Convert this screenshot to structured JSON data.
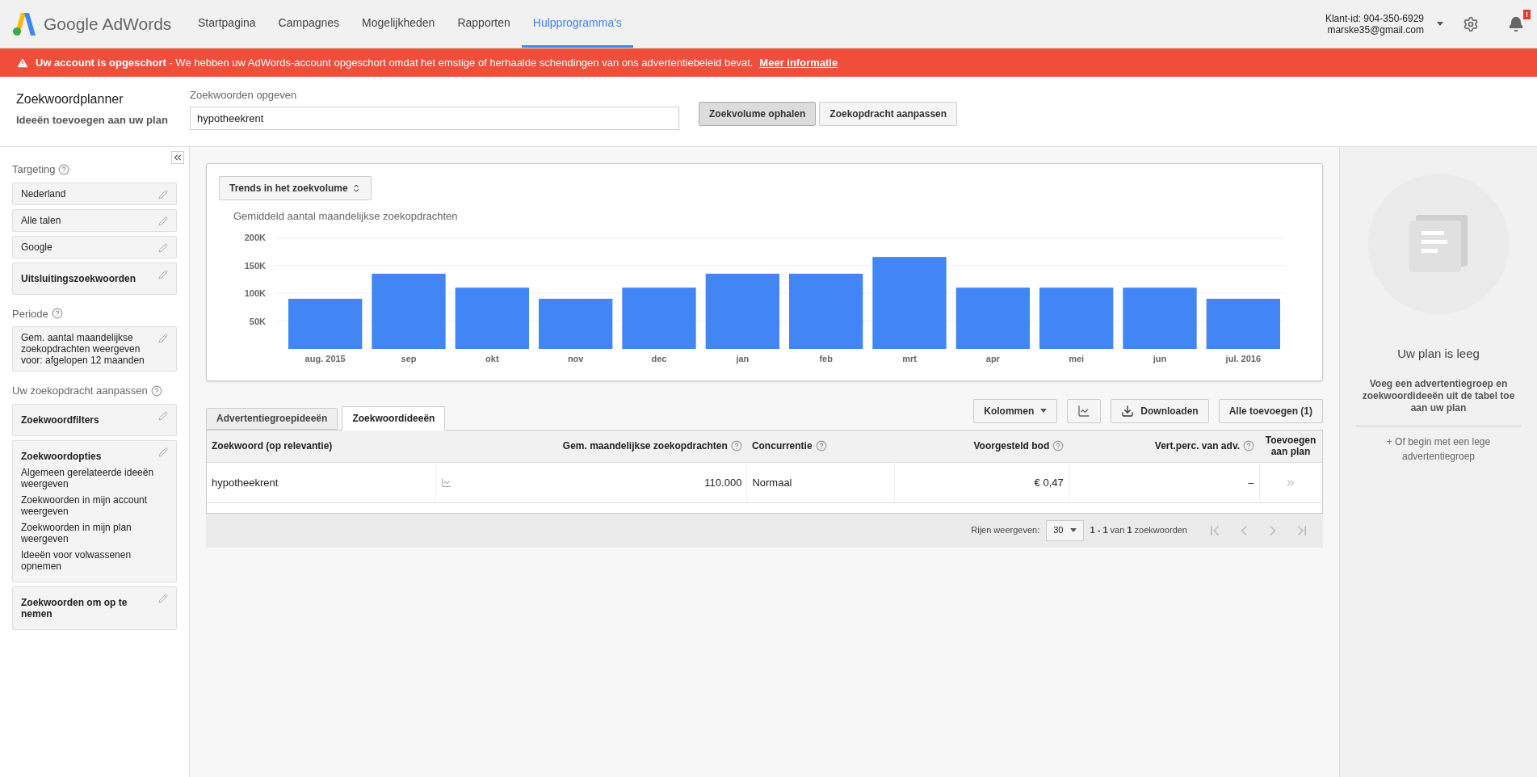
{
  "header": {
    "logo_text": "Google AdWords",
    "nav": [
      {
        "label": "Startpagina",
        "selected": false
      },
      {
        "label": "Campagnes",
        "selected": false
      },
      {
        "label": "Mogelijkheden",
        "selected": false
      },
      {
        "label": "Rapporten",
        "selected": false
      },
      {
        "label": "Hulpprogramma's",
        "selected": true
      }
    ],
    "client_id": "Klant-id: 904-350-6929",
    "email": "marske35@gmail.com",
    "notification_badge": "!"
  },
  "banner": {
    "text": "**Uw account is opgeschort** - We hebben uw AdWords-account opgeschort omdat het emstige of herhaalde schendingen van ons advertentiebeleid bevat.",
    "link": "Meer informatie"
  },
  "planner": {
    "title": "Zoekwoordplanner",
    "subtitle": "Ideeën toevoegen aan uw plan",
    "field_label": "Zoekwoorden opgeven",
    "field_value": "hypotheekrent",
    "buttons": [
      {
        "label": "Zoekvolume ophalen",
        "selected": true
      },
      {
        "label": "Zoekopdracht aanpassen",
        "selected": false
      }
    ]
  },
  "sidebar": {
    "sections": [
      {
        "heading": "Targeting",
        "items": [
          {
            "title": "Nederland",
            "bold": false
          },
          {
            "title": "Alle talen",
            "bold": false
          },
          {
            "title": "Google",
            "bold": false
          },
          {
            "title": "Uitsluitingszoekwoorden",
            "bold": true
          }
        ]
      },
      {
        "heading": "Periode",
        "items": [
          {
            "title": "Gem. aantal maandelijkse zoekopdrachten weergeven voor: afgelopen 12 maanden",
            "bold": false
          }
        ]
      },
      {
        "heading": "Uw zoekopdracht aanpassen",
        "items": [
          {
            "title": "Zoekwoordfilters",
            "bold": true
          },
          {
            "title": "Zoekwoordopties",
            "bold": true,
            "lines": [
              "Algemeen gerelateerde ideeën weergeven",
              "Zoekwoorden in mijn account weergeven",
              "Zoekwoorden in mijn plan weergeven",
              "Ideeën voor volwassenen opnemen"
            ]
          },
          {
            "title": "Zoekwoorden om op te nemen",
            "bold": true
          }
        ]
      }
    ]
  },
  "trend": {
    "dropdown": "Trends in het zoekvolume",
    "chart_data": {
      "type": "bar",
      "title": "Gemiddeld aantal maandelijkse zoekopdrachten",
      "categories": [
        "aug. 2015",
        "sep",
        "okt",
        "nov",
        "dec",
        "jan",
        "feb",
        "mrt",
        "apr",
        "mei",
        "jun",
        "jul. 2016"
      ],
      "series": [
        {
          "color": "#4285f4",
          "values": [
            90000,
            135000,
            110000,
            90000,
            110000,
            135000,
            135000,
            165000,
            110000,
            110000,
            110000,
            90000
          ]
        }
      ],
      "grid": true,
      "ylim": [
        0,
        200000
      ],
      "yticks": [
        {
          "value": 50000,
          "label": "50K"
        },
        {
          "value": 100000,
          "label": "100K"
        },
        {
          "value": 150000,
          "label": "150K"
        },
        {
          "value": 200000,
          "label": "200K"
        }
      ]
    }
  },
  "tabs": [
    {
      "label": "Advertentiegroepideeën",
      "selected": false
    },
    {
      "label": "Zoekwoordideeën",
      "selected": true
    }
  ],
  "toolbar": {
    "columns_button": "Kolommen",
    "download_button": "Downloaden",
    "add_all_button": "Alle toevoegen (1)"
  },
  "table": {
    "columns": [
      {
        "label": "Zoekwoord (op relevantie)",
        "help": false
      },
      {
        "label": "Gem. maandelijkse zoekopdrachten",
        "help": true
      },
      {
        "label": "Concurrentie",
        "help": true
      },
      {
        "label": "Voorgesteld bod",
        "help": true
      },
      {
        "label": "Vert.perc. van adv.",
        "help": true
      },
      {
        "label": "Toevoegen aan plan",
        "help": false
      }
    ],
    "rows": [
      {
        "keyword": "hypotheekrent",
        "searches": "110.000",
        "competition": "Normaal",
        "bid": "€ 0,47",
        "share": "–"
      }
    ]
  },
  "pagination": {
    "label": "Rijen weergeven:",
    "rows_value": "30",
    "range": "**1 - 1** van **1** zoekwoorden"
  },
  "plan": {
    "title": "Uw plan is leeg",
    "text": "Voeg een advertentiegroep en zoekwoordideeën uit de tabel toe aan uw plan",
    "link": "+ Of begin met een lege advertentiegroep"
  }
}
